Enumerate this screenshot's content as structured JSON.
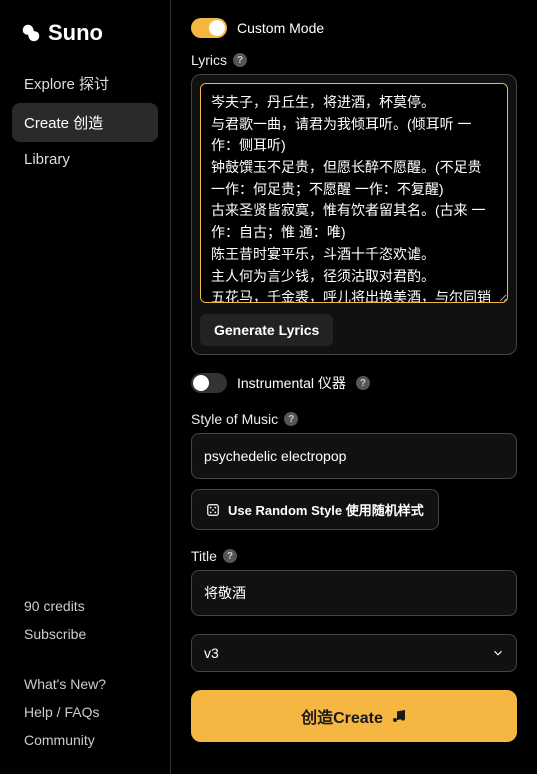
{
  "brand": "Suno",
  "sidebar": {
    "items": [
      {
        "label": "Explore 探讨",
        "active": false
      },
      {
        "label": "Create 创造",
        "active": true
      },
      {
        "label": "Library",
        "active": false
      }
    ],
    "credits": "90 credits",
    "subscribe": "Subscribe",
    "footer": [
      "What's New?",
      "Help / FAQs",
      "Community"
    ]
  },
  "main": {
    "custom_mode_label": "Custom Mode",
    "custom_mode_on": true,
    "lyrics_label": "Lyrics",
    "lyrics_value": "岑夫子，丹丘生，将进酒，杯莫停。\n与君歌一曲，请君为我倾耳听。(倾耳听 一作：侧耳听)\n钟鼓馔玉不足贵，但愿长醉不愿醒。(不足贵 一作：何足贵；不愿醒 一作：不复醒)\n古来圣贤皆寂寞，惟有饮者留其名。(古来 一作：自古；惟 通：唯)\n陈王昔时宴平乐，斗酒十千恣欢谑。\n主人何为言少钱，径须沽取对君酌。\n五花马，千金裘，呼儿将出换美酒，与尔同销万古愁。",
    "generate_lyrics": "Generate Lyrics",
    "instrumental_label": "Instrumental 仪器",
    "instrumental_on": false,
    "style_label": "Style of Music",
    "style_value": "psychedelic electropop",
    "random_style": "Use Random Style 使用随机样式",
    "title_label": "Title",
    "title_value": "将敬酒",
    "version_value": "v3",
    "create_label": "创造Create"
  }
}
